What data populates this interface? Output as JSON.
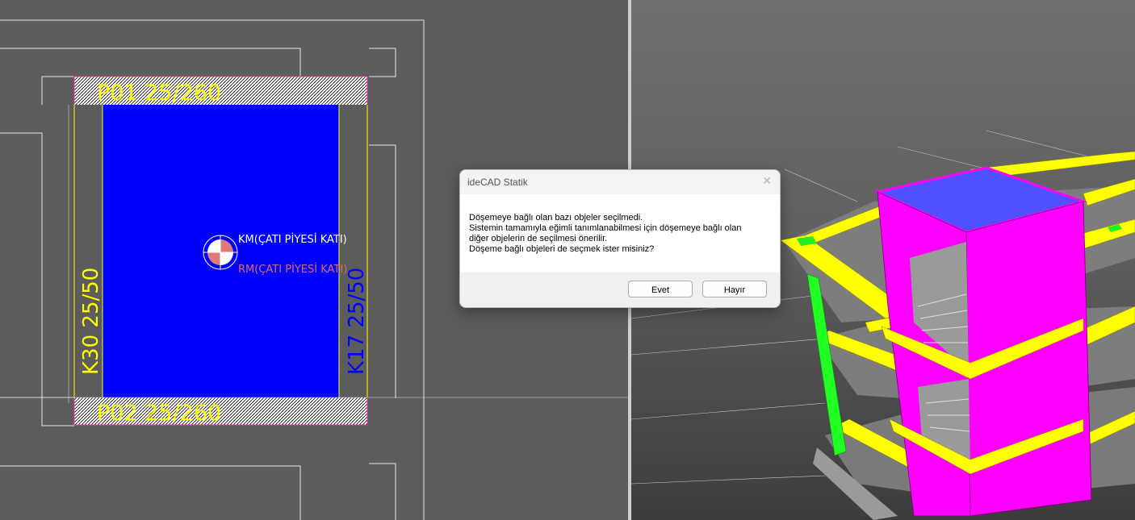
{
  "plan": {
    "beam_top_label": "P01 25/260",
    "beam_bottom_label": "P02 25/260",
    "beam_left_label": "K30 25/50",
    "beam_right_label": "K17 25/50",
    "mass_center_label": "KM(ÇATI PİYESİ KATI)",
    "rigidity_center_label": "RM(ÇATI PİYESİ KATI)",
    "colors": {
      "background": "#5c5c5c",
      "slab": "#0000ff",
      "beam_label": "#ffff00",
      "right_beam_label": "#0000ff",
      "gridline": "#e8e8e8"
    }
  },
  "model": {
    "colors": {
      "columns": "#ff00ff",
      "beams": "#ffff00",
      "slab_top": "#5050ff",
      "edge_column": "#00ff00"
    }
  },
  "dialog": {
    "title": "ideCAD Statik",
    "close_icon": "close-icon",
    "lines": [
      "Döşemeye bağlı olan bazı objeler seçilmedi.",
      "Sistemin tamamıyla eğimli tanımlanabilmesi için döşemeye bağlı olan",
      "diğer objelerin de seçilmesi önerilir.",
      "Döşeme bağlı objeleri de seçmek ister misiniz?"
    ],
    "yes_label": "Evet",
    "no_label": "Hayır"
  }
}
